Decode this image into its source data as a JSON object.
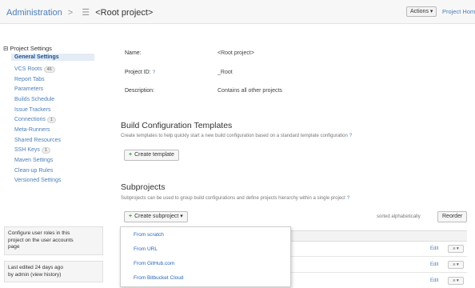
{
  "breadcrumb": {
    "root": "Administration",
    "separator": ">",
    "current": "<Root project>"
  },
  "header": {
    "actions_label": "Actions ▾",
    "project_home_label": "Project Home"
  },
  "sidebar": {
    "heading": "Project Settings",
    "items": [
      {
        "label": "General Settings",
        "active": true
      },
      {
        "label": "VCS Roots",
        "badge": "46"
      },
      {
        "label": "Report Tabs"
      },
      {
        "label": "Parameters"
      },
      {
        "label": "Builds Schedule"
      },
      {
        "label": "Issue Trackers"
      },
      {
        "label": "Connections",
        "badge": "1"
      },
      {
        "label": "Meta-Runners"
      },
      {
        "label": "Shared Resources"
      },
      {
        "label": "SSH Keys",
        "badge": "1"
      },
      {
        "label": "Maven Settings"
      },
      {
        "label": "Clean-up Rules"
      },
      {
        "label": "Versioned Settings"
      }
    ],
    "roles_box": {
      "line1": "Configure user roles in this",
      "line2": "project on the user accounts",
      "line3": "page"
    },
    "edit_box": {
      "line1": "Last edited 24 days ago",
      "line2": "by admin (view history)"
    }
  },
  "general": {
    "name_label": "Name:",
    "name_value": "<Root project>",
    "id_label": "Project ID:",
    "id_value": "_Root",
    "desc_label": "Description:",
    "desc_value": "Contains all other projects"
  },
  "templates": {
    "title": "Build Configuration Templates",
    "description": "Create templates to help quickly start a new build configuration based on a standard template configuration",
    "create_button": "Create template"
  },
  "subprojects": {
    "title": "Subprojects",
    "description": "Subprojects can be used to group build configurations and define projects hierarchy within a single project",
    "create_button": "Create subproject ▾",
    "sort_label": "sorted alphabetically",
    "reorder_button": "Reorder",
    "edit_label": "Edit",
    "row_dropdown": "≡ ▾"
  },
  "dropdown": {
    "items": [
      "From scratch",
      "From URL",
      "From GitHub.com",
      "From Bitbucket Cloud"
    ]
  },
  "colors": {
    "link": "#2a68b6",
    "active_bg": "#e4ecf6",
    "plus": "#3a9a3a"
  }
}
